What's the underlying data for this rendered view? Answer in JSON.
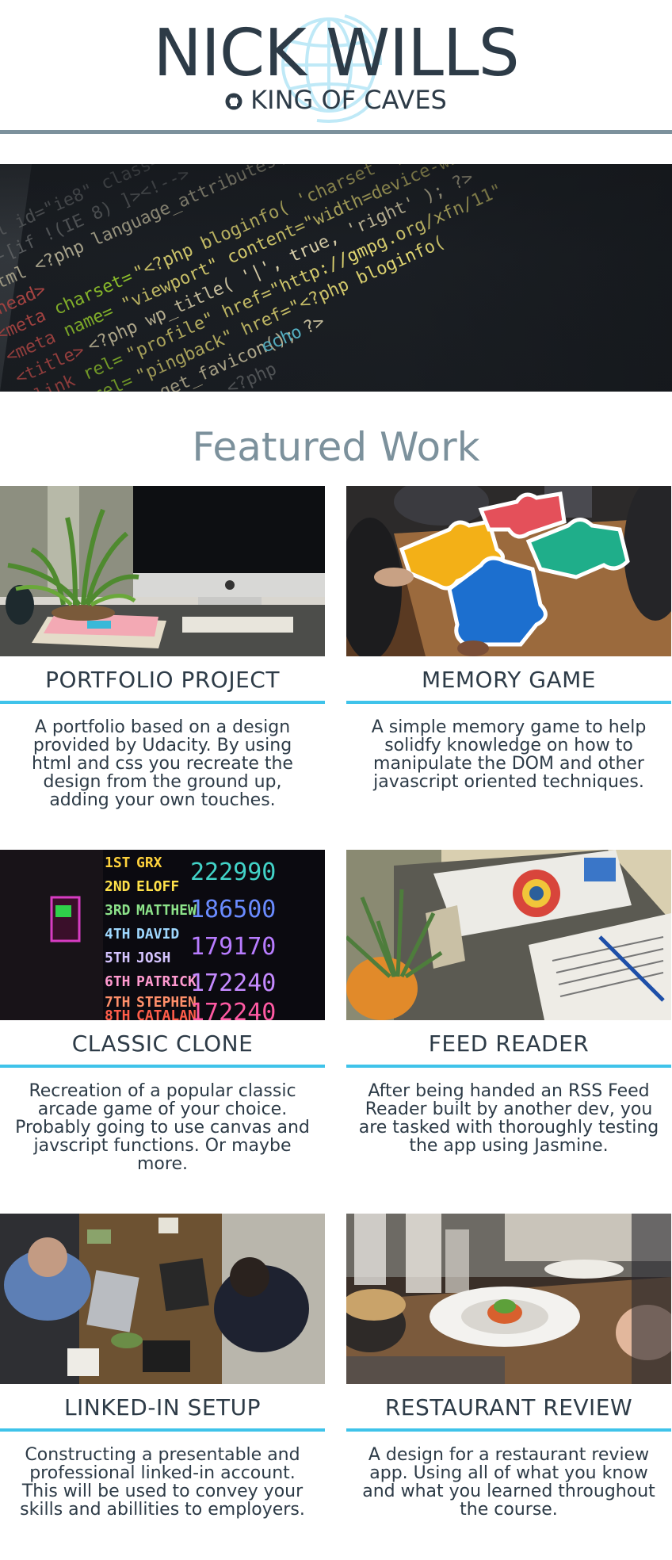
{
  "header": {
    "name": "NICK WILLS",
    "tagline": "KING OF CAVES",
    "tagline_icon": "github-icon",
    "logo_icon": "globe-logo-icon"
  },
  "hero": {
    "image": "code-editor-photo"
  },
  "featured": {
    "title": "Featured Work",
    "projects": [
      {
        "title": "PORTFOLIO PROJECT",
        "description": "A portfolio based on a design provided by Udacity. By using html and css you recreate the design from the ground up, adding your own touches.",
        "image": "desk-computer-plant-photo"
      },
      {
        "title": "MEMORY GAME",
        "description": "A simple memory game to help solidfy knowledge on how to manipulate the DOM and other javascript oriented techniques.",
        "image": "puzzle-pieces-photo"
      },
      {
        "title": "CLASSIC CLONE",
        "description": "Recreation of a popular classic arcade game of your choice. Probably going to use canvas and javscript functions. Or maybe more.",
        "image": "arcade-high-score-photo"
      },
      {
        "title": "FEED READER",
        "description": "After being handed an RSS Feed Reader built by another dev, you are tasked with thoroughly testing the app using Jasmine.",
        "image": "newspapers-plant-photo"
      },
      {
        "title": "LINKED-IN SETUP",
        "description": "Constructing a presentable and professional linked-in account. This will be used to convey your skills and abillities to employers.",
        "image": "meeting-laptops-photo"
      },
      {
        "title": "RESTAURANT REVIEW",
        "description": "A design for a restaurant review app. Using all of what you know and what you learned throughout the course.",
        "image": "restaurant-dish-photo"
      }
    ]
  },
  "colors": {
    "text": "#2d3b47",
    "muted": "#7c919c",
    "accent": "#3fc3ea",
    "background": "#ffffff"
  }
}
